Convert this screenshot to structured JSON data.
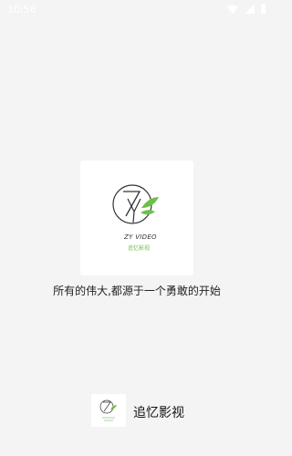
{
  "status_bar": {
    "time": "10:56",
    "icons": [
      "wifi-icon",
      "signal-icon",
      "battery-icon"
    ]
  },
  "splash": {
    "logo_text_en": "ZY VIDEO",
    "logo_text_cn": "追忆影视",
    "slogan": "所有的伟大,都源于一个勇敢的开始"
  },
  "footer": {
    "app_name": "追忆影视"
  },
  "colors": {
    "background": "#f4f4f4",
    "leaf_green": "#6cc04a",
    "logo_stroke": "#333333"
  }
}
